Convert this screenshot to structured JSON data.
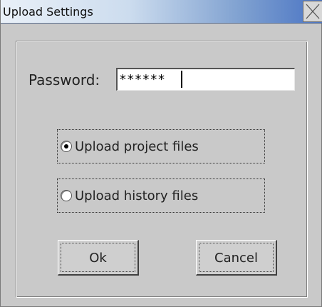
{
  "window": {
    "title": "Upload Settings"
  },
  "form": {
    "password_label": "Password:",
    "password_value": "******"
  },
  "options": [
    {
      "label": "Upload project files",
      "selected": true
    },
    {
      "label": "Upload history files",
      "selected": false
    }
  ],
  "buttons": {
    "ok_label": "Ok",
    "cancel_label": "Cancel"
  },
  "icons": {
    "close": "close-icon"
  }
}
